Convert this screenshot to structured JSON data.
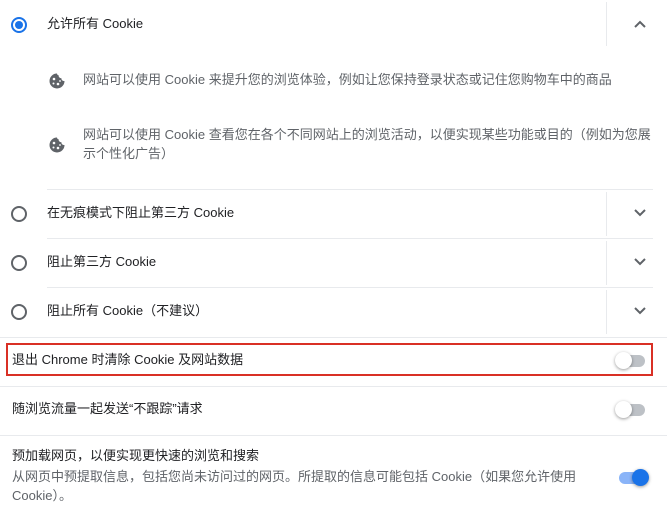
{
  "cookie_options": {
    "allow_all": {
      "label": "允许所有 Cookie",
      "checked": true,
      "desc_1": "网站可以使用 Cookie 来提升您的浏览体验，例如让您保持登录状态或记住您购物车中的商品",
      "desc_2": "网站可以使用 Cookie 查看您在各个不同网站上的浏览活动，以便实现某些功能或目的（例如为您展示个性化广告）"
    },
    "block_third_party_incognito": {
      "label": "在无痕模式下阻止第三方 Cookie",
      "checked": false
    },
    "block_third_party": {
      "label": "阻止第三方 Cookie",
      "checked": false
    },
    "block_all": {
      "label": "阻止所有 Cookie（不建议）",
      "checked": false
    }
  },
  "toggles": {
    "clear_on_exit": {
      "label": "退出 Chrome 时清除 Cookie 及网站数据",
      "on": false
    },
    "do_not_track": {
      "label": "随浏览流量一起发送“不跟踪”请求",
      "on": false
    },
    "preload": {
      "label": "预加载网页，以便实现更快速的浏览和搜索",
      "desc": "从网页中预提取信息，包括您尚未访问过的网页。所提取的信息可能包括 Cookie（如果您允许使用 Cookie）。",
      "on": true
    }
  },
  "icons": {
    "expanded": "chevron-up-icon",
    "collapsed": "chevron-down-icon",
    "info": "cookie-icon"
  },
  "colors": {
    "accent": "#1a73e8",
    "highlight": "#d93025"
  }
}
